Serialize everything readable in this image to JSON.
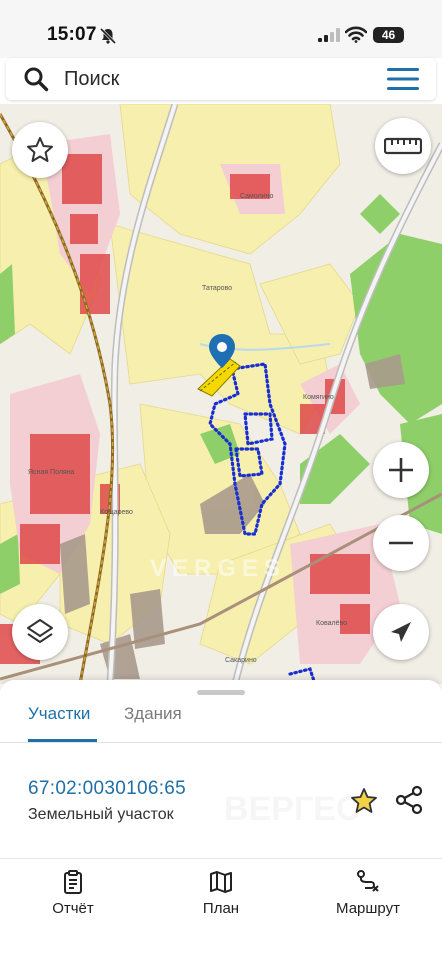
{
  "status_bar": {
    "time": "15:07",
    "battery": "46",
    "icons": [
      "bell-slash-icon",
      "cellular-signal-icon",
      "wifi-icon",
      "battery-icon"
    ]
  },
  "search": {
    "placeholder": "Поиск",
    "value": "",
    "icon": "search-icon",
    "menu_icon": "hamburger-menu-icon"
  },
  "map": {
    "watermark": "VERGES",
    "colors": {
      "base": "#f1eee6",
      "agricultural": "#f7efad",
      "forest": "#8fcf6a",
      "settlement": "#f3cfd3",
      "buildings": "#e04a4a",
      "selected_outline": "#1a2fd0",
      "selected_fill": "#f5d800",
      "marker": "#1f6fb5",
      "road": "#c4c4c4"
    },
    "place_labels": [
      {
        "name": "Самолино"
      },
      {
        "name": "Татарово"
      },
      {
        "name": "Комягино"
      },
      {
        "name": "Кощарево"
      },
      {
        "name": "Сакарино"
      },
      {
        "name": "Ясная Поляна"
      },
      {
        "name": "Ковалёво"
      }
    ],
    "controls": {
      "favorite": "star-outline-icon",
      "ruler": "ruler-icon",
      "zoom_in": "plus-icon",
      "zoom_out": "minus-icon",
      "layers": "layers-icon",
      "locate": "navigation-arrow-icon"
    }
  },
  "sheet": {
    "tabs": [
      {
        "label": "Участки",
        "active": true
      },
      {
        "label": "Здания",
        "active": false
      }
    ],
    "parcel": {
      "cadastral_number": "67:02:0030106:65",
      "type": "Земельный участок"
    },
    "watermark": "ВЕРГЕС"
  },
  "bottom_nav": {
    "items": [
      {
        "label": "Отчёт",
        "icon": "clipboard-icon"
      },
      {
        "label": "План",
        "icon": "map-icon"
      },
      {
        "label": "Маршрут",
        "icon": "route-icon"
      }
    ]
  }
}
